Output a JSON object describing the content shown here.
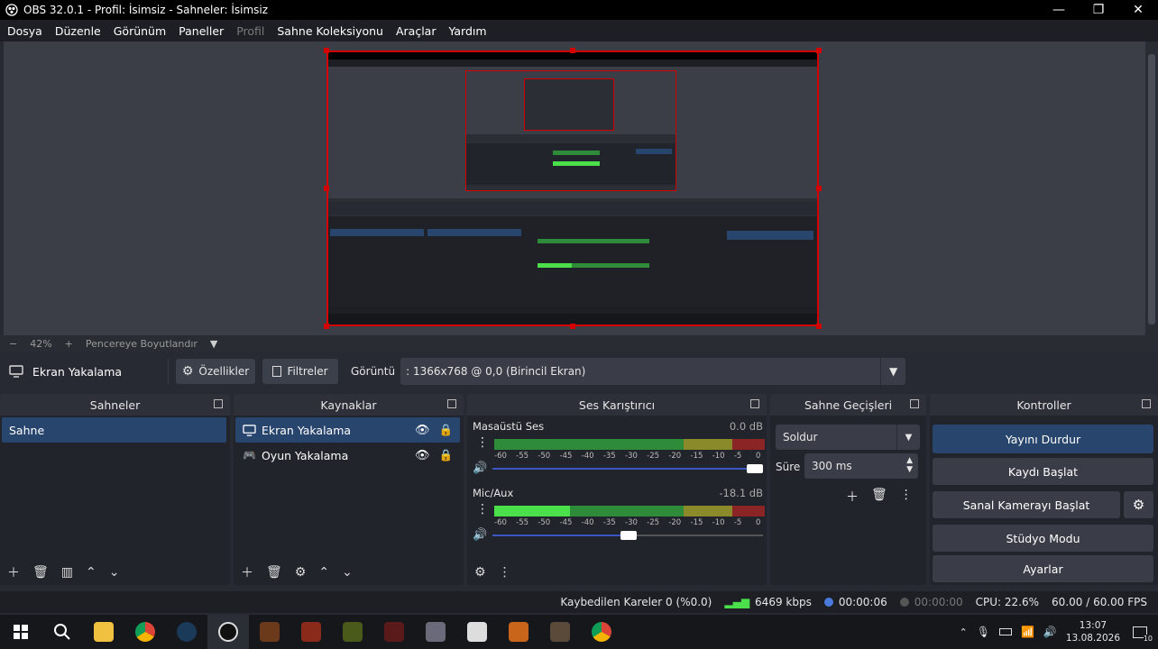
{
  "window": {
    "title": "OBS 32.0.1 - Profil: İsimsiz - Sahneler: İsimsiz"
  },
  "menu": {
    "items": [
      {
        "label": "Dosya",
        "enabled": true
      },
      {
        "label": "Düzenle",
        "enabled": true
      },
      {
        "label": "Görünüm",
        "enabled": true
      },
      {
        "label": "Paneller",
        "enabled": true
      },
      {
        "label": "Profil",
        "enabled": false
      },
      {
        "label": "Sahne Koleksiyonu",
        "enabled": true
      },
      {
        "label": "Araçlar",
        "enabled": true
      },
      {
        "label": "Yardım",
        "enabled": true
      }
    ]
  },
  "zoom": {
    "minus": "−",
    "level": "42%",
    "plus": "+",
    "fit_label": "Pencereye Boyutlandır"
  },
  "sourcebar": {
    "source_name": "Ekran Yakalama",
    "properties_label": "Özellikler",
    "filters_label": "Filtreler",
    "display_label": "Görüntü",
    "display_value": ": 1366x768 @ 0,0 (Birincil Ekran)"
  },
  "scenes": {
    "title": "Sahneler",
    "items": [
      "Sahne"
    ]
  },
  "sources": {
    "title": "Kaynaklar",
    "items": [
      "Ekran Yakalama",
      "Oyun Yakalama"
    ]
  },
  "mixer": {
    "title": "Ses Karıştırıcı",
    "channels": [
      {
        "name": "Masaüstü Ses",
        "db": "0.0 dB",
        "level": 0.0,
        "volume": 1.0
      },
      {
        "name": "Mic/Aux",
        "db": "-18.1 dB",
        "level": 0.28,
        "volume": 0.5
      }
    ],
    "scale": [
      "-60",
      "-55",
      "-50",
      "-45",
      "-40",
      "-35",
      "-30",
      "-25",
      "-20",
      "-15",
      "-10",
      "-5",
      "0"
    ]
  },
  "transitions": {
    "title": "Sahne Geçişleri",
    "selected": "Soldur",
    "duration_label": "Süre",
    "duration_value": "300 ms"
  },
  "controls": {
    "title": "Kontroller",
    "stop_stream": "Yayını Durdur",
    "start_record": "Kaydı Başlat",
    "virtual_cam": "Sanal Kamerayı Başlat",
    "studio_mode": "Stüdyo Modu",
    "settings": "Ayarlar"
  },
  "status": {
    "dropped": "Kaybedilen Kareler 0 (%0.0)",
    "bitrate": "6469 kbps",
    "stream_time": "00:00:06",
    "record_time": "00:00:00",
    "cpu": "CPU: 22.6%",
    "fps": "60.00 / 60.00 FPS"
  },
  "taskbar": {
    "time": "13:07",
    "date": "13.08.2026",
    "notifications": "10"
  },
  "colors": {
    "accent": "#28456e",
    "selection": "#d40000",
    "meter_green": "#2e8b3a",
    "meter_yellow": "#8a8a2a",
    "meter_red": "#8b2525",
    "meter_active": "#4be04b"
  }
}
